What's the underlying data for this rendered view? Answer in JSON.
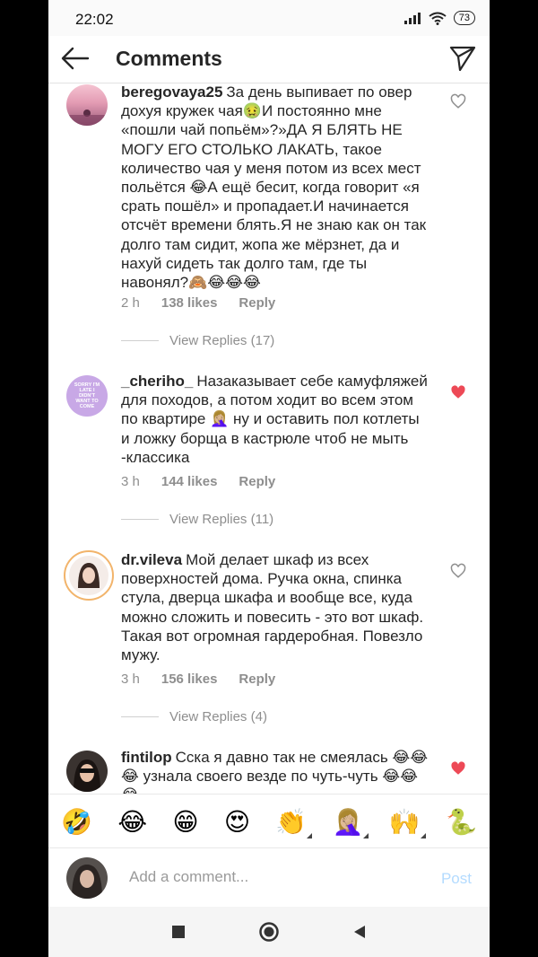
{
  "status": {
    "time": "22:02",
    "battery": "73"
  },
  "header": {
    "title": "Comments"
  },
  "comments": [
    {
      "username": "beregovaya25",
      "text": "За день выпивает по овер дохуя кружек чая🤢И постоянно мне «пошли чай попьём»?»ДА Я БЛЯТЬ НЕ МОГУ ЕГО СТОЛЬКО ЛАКАТЬ, такое количество чая у меня потом из всех мест польётся 😂А ещё бесит, когда говорит «я срать пошёл» и пропадает.И начинается отсчёт времени блять.Я не знаю как он так долго там сидит, жопа же мёрзнет, да и нахуй сидеть так долго там, где ты навонял?🙈😂😂😂",
      "time": "2 h",
      "likes": "138 likes",
      "reply": "Reply",
      "view_replies": "View Replies (17)",
      "liked": false
    },
    {
      "username": "_cheriho_",
      "text": "Назаказывает себе камуфляжей для походов, а потом ходит во всем этом по квартире 🤦🏼‍♀️ ну и оставить пол котлеты и ложку борща в кастрюле чтоб не мыть -классика",
      "time": "3 h",
      "likes": "144 likes",
      "reply": "Reply",
      "view_replies": "View Replies (11)",
      "liked": true
    },
    {
      "username": "dr.vileva",
      "text": "Мой делает шкаф из всех поверхностей дома. Ручка окна, спинка стула, дверца шкафа и вообще все, куда можно сложить и повесить - это вот шкаф. Такая вот огромная гардеробная. Повезло мужу.",
      "time": "3 h",
      "likes": "156 likes",
      "reply": "Reply",
      "view_replies": "View Replies (4)",
      "liked": false
    },
    {
      "username": "fintilop",
      "text": "Сска я давно так не смеялась 😂😂😂 узнала своего везде по чуть-чуть 😂😂😂",
      "liked": true
    }
  ],
  "cheriho_avatar_text": "SORRY I'M LATE I DIDN'T WANT TO COME",
  "emoji_bar": [
    "🤣",
    "😂",
    "😁",
    "😍",
    "👏",
    "🤦🏼‍♀️",
    "🙌",
    "🐍"
  ],
  "input": {
    "placeholder": "Add a comment...",
    "post": "Post"
  },
  "colors": {
    "heart_red": "#ed4956",
    "post_disabled": "#b3dbff",
    "meta_gray": "#8e8e8e"
  }
}
